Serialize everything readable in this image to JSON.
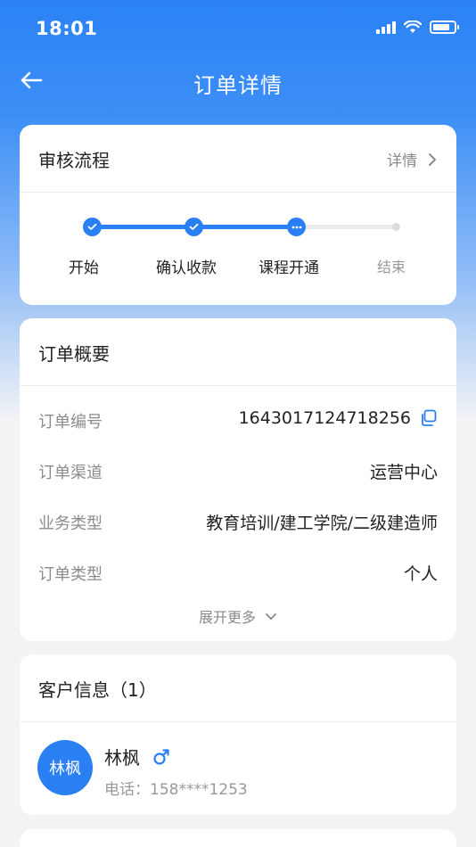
{
  "status_bar": {
    "time": "18:01"
  },
  "nav": {
    "title": "订单详情",
    "back_icon": "arrow-left-icon"
  },
  "review": {
    "title": "审核流程",
    "detail_label": "详情",
    "steps": [
      {
        "label": "开始",
        "state": "done"
      },
      {
        "label": "确认收款",
        "state": "done"
      },
      {
        "label": "课程开通",
        "state": "current"
      },
      {
        "label": "结束",
        "state": "pending"
      }
    ]
  },
  "summary": {
    "title": "订单概要",
    "rows": [
      {
        "key": "订单编号",
        "value": "1643017124718256"
      },
      {
        "key": "订单渠道",
        "value": "运营中心"
      },
      {
        "key": "业务类型",
        "value": "教育培训/建工学院/二级建造师"
      },
      {
        "key": "订单类型",
        "value": "个人"
      }
    ],
    "expand_label": "展开更多"
  },
  "customer": {
    "title": "客户信息（1）",
    "avatar_text": "林枫",
    "name": "林枫",
    "gender_icon": "male-icon",
    "phone": "电话：158****1253"
  },
  "colors": {
    "accent": "#2a7ff3",
    "muted": "#8c8c8c"
  }
}
